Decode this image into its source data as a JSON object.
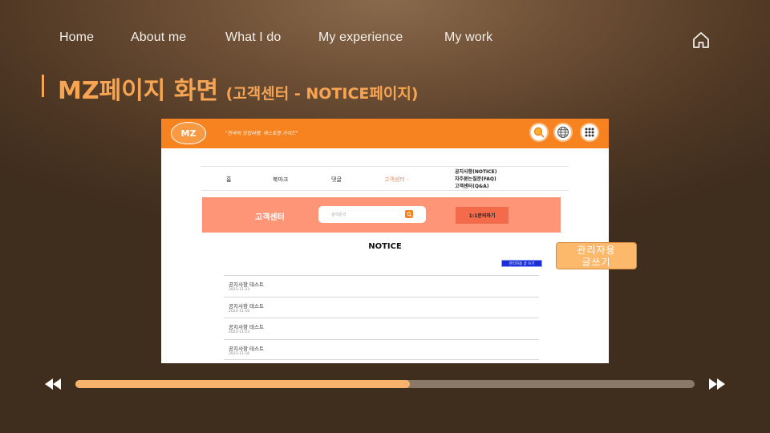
{
  "nav": {
    "items": [
      {
        "label": "Home"
      },
      {
        "label": "About me"
      },
      {
        "label": "What I do"
      },
      {
        "label": "My experience"
      },
      {
        "label": "My work"
      }
    ],
    "home_icon": "home-icon"
  },
  "slide": {
    "title": "MZ페이지 화면",
    "subtitle": "(고객센터 - NOTICE페이지)"
  },
  "screenshot": {
    "header": {
      "logo_text": "MZ",
      "tagline": "\"한국의 맛집여행, 레스토랑 가이드\"",
      "icons": [
        "search-icon",
        "globe-icon",
        "grid-menu-icon"
      ],
      "brand_color": "#f6831f"
    },
    "subnav": {
      "items": [
        {
          "label": "홈"
        },
        {
          "label": "북마크"
        },
        {
          "label": "댓글"
        },
        {
          "label": "고객센터 -"
        }
      ],
      "dropdown": [
        "공지사항(NOTICE)",
        "자주묻는질문(FAQ)",
        "고객센터(Q&A)"
      ]
    },
    "cs": {
      "title": "고객센터",
      "search_placeholder": "검색문의",
      "inquiry_button": "1:1문의하기",
      "band_color": "#fd9576"
    },
    "notice": {
      "heading": "NOTICE",
      "admin_write": "관리자용 글 쓰기",
      "rows": [
        {
          "title": "공지사항 테스트",
          "date": "2023-11-23"
        },
        {
          "title": "공지사항 테스트",
          "date": "2023-11-16"
        },
        {
          "title": "공지사항 테스트",
          "date": "2023-11-23"
        },
        {
          "title": "공지사항 테스트",
          "date": "2023-11-16"
        }
      ]
    }
  },
  "admin_callout": {
    "line1": "관리자용",
    "line2": "글쓰기"
  },
  "player": {
    "rewind_icon": "rewind-icon",
    "forward_icon": "fast-forward-icon",
    "progress": 0.54,
    "progress_color": "#f7b36c"
  }
}
